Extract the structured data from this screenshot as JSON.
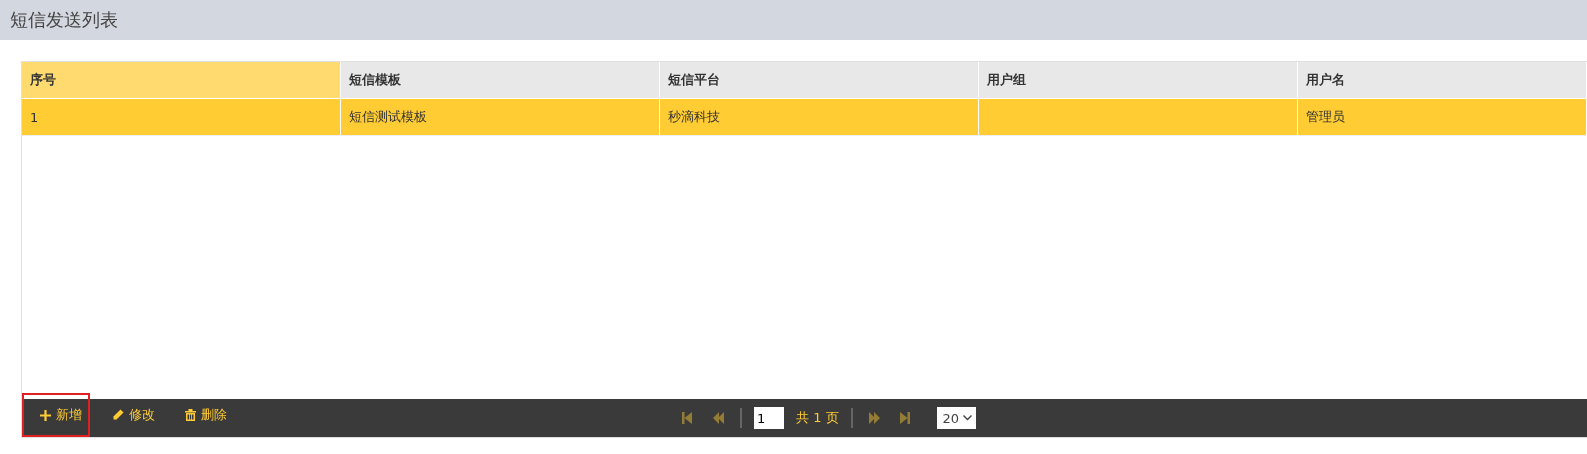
{
  "title": "短信发送列表",
  "table": {
    "columns": [
      {
        "label": "序号",
        "highlighted": true
      },
      {
        "label": "短信模板",
        "highlighted": false
      },
      {
        "label": "短信平台",
        "highlighted": false
      },
      {
        "label": "用户组",
        "highlighted": false
      },
      {
        "label": "用户名",
        "highlighted": false
      }
    ],
    "rows": [
      {
        "selected": true,
        "cells": [
          "1",
          "短信测试模板",
          "秒滴科技",
          "",
          "管理员"
        ]
      }
    ]
  },
  "toolbar": {
    "actions": [
      {
        "kind": "add",
        "label": "新增",
        "highlighted": true
      },
      {
        "kind": "edit",
        "label": "修改",
        "highlighted": false
      },
      {
        "kind": "delete",
        "label": "删除",
        "highlighted": false
      }
    ],
    "pager": {
      "buttons": [
        {
          "kind": "first",
          "disabled": true
        },
        {
          "kind": "prev",
          "disabled": true
        },
        {
          "kind": "next",
          "disabled": true
        },
        {
          "kind": "last",
          "disabled": true
        }
      ],
      "page": "1",
      "total": "共 1 页",
      "page_size": "20"
    }
  }
}
